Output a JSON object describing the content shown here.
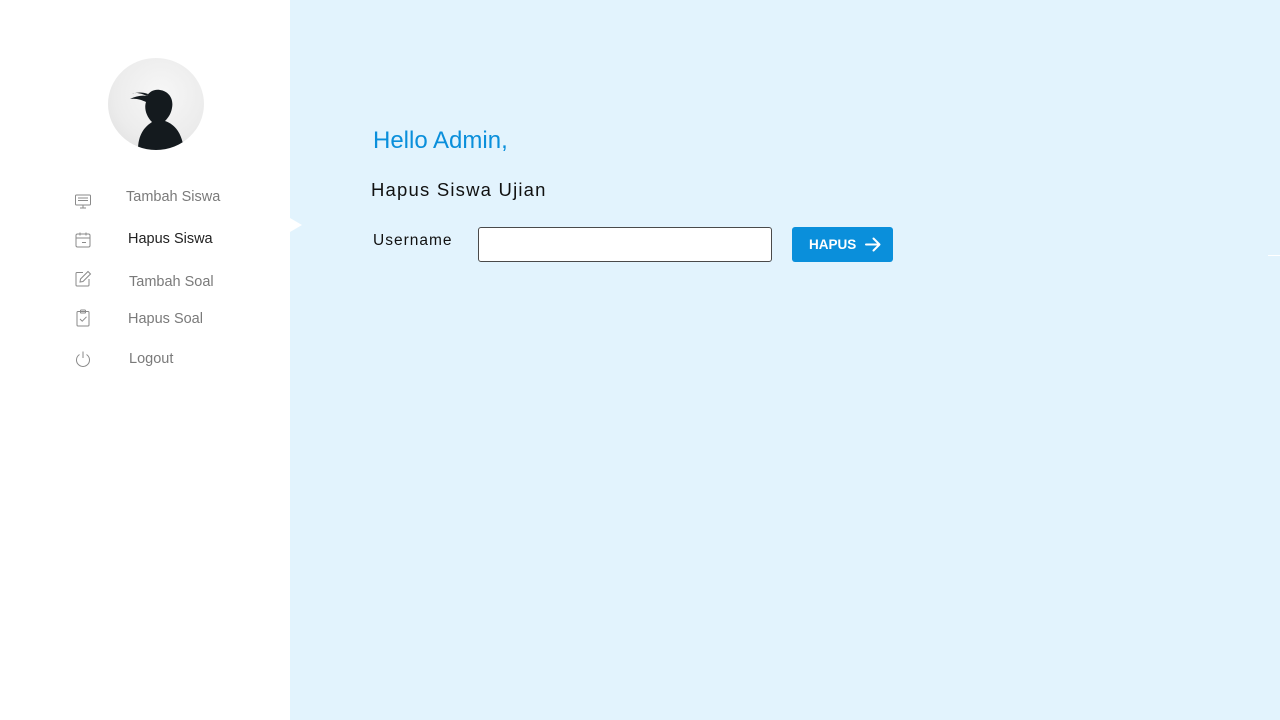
{
  "sidebar": {
    "avatar_alt": "",
    "items": [
      {
        "label": "Tambah Siswa",
        "icon": "monitor-icon",
        "active": false
      },
      {
        "label": "Hapus Siswa",
        "icon": "calendar-icon",
        "active": true
      },
      {
        "label": "Tambah Soal",
        "icon": "edit-icon",
        "active": false
      },
      {
        "label": "Hapus Soal",
        "icon": "clipboard-check-icon",
        "active": false
      },
      {
        "label": "Logout",
        "icon": "power-icon",
        "active": false
      }
    ]
  },
  "main": {
    "greeting": "Hello Admin,",
    "title": "Hapus Siswa Ujian",
    "form": {
      "username_label": "Username",
      "username_value": "",
      "submit_label": "HAPUS",
      "submit_icon": "arrow-right-icon"
    }
  },
  "colors": {
    "accent": "#0a8fdb",
    "background": "#e2f3fd",
    "sidebar": "#ffffff"
  }
}
